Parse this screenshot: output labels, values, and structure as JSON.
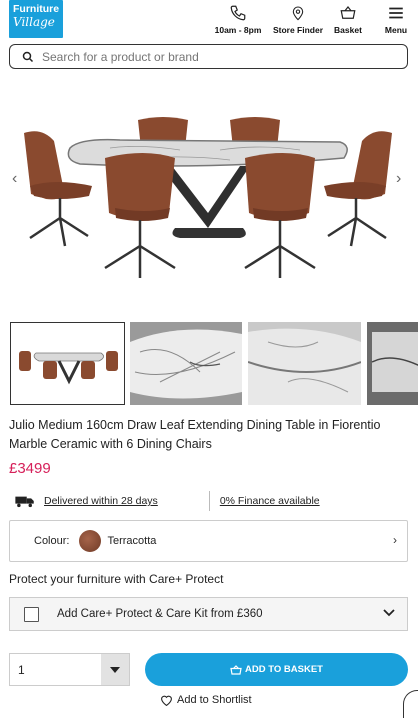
{
  "brand": {
    "line1": "Furniture",
    "line2": "Village"
  },
  "header": {
    "phone_label": "10am - 8pm",
    "store_label": "Store Finder",
    "basket_label": "Basket",
    "menu_label": "Menu"
  },
  "search": {
    "placeholder": "Search for a product or brand"
  },
  "product": {
    "title": "Julio Medium 160cm Draw Leaf Extending Dining Table in Fiorentio Marble Ceramic with 6 Dining Chairs",
    "price": "£3499",
    "delivery": "Delivered within 28 days",
    "finance": "0% Finance available",
    "colour_label": "Colour:",
    "colour_value": "Terracotta"
  },
  "care": {
    "heading": "Protect your furniture with Care+ Protect",
    "option_label": "Add Care+ Protect & Care Kit from £360"
  },
  "purchase": {
    "quantity": "1",
    "add_to_basket": "ADD TO BASKET",
    "shortlist": "Add to Shortlist"
  },
  "colors": {
    "brand_blue": "#1aa0db",
    "price_pink": "#d6205a",
    "chair": "#8a4a2f"
  },
  "icons": [
    "phone-icon",
    "location-pin-icon",
    "basket-icon",
    "menu-icon",
    "search-icon",
    "truck-icon",
    "chevron-right-icon",
    "chevron-down-icon",
    "heart-icon"
  ]
}
